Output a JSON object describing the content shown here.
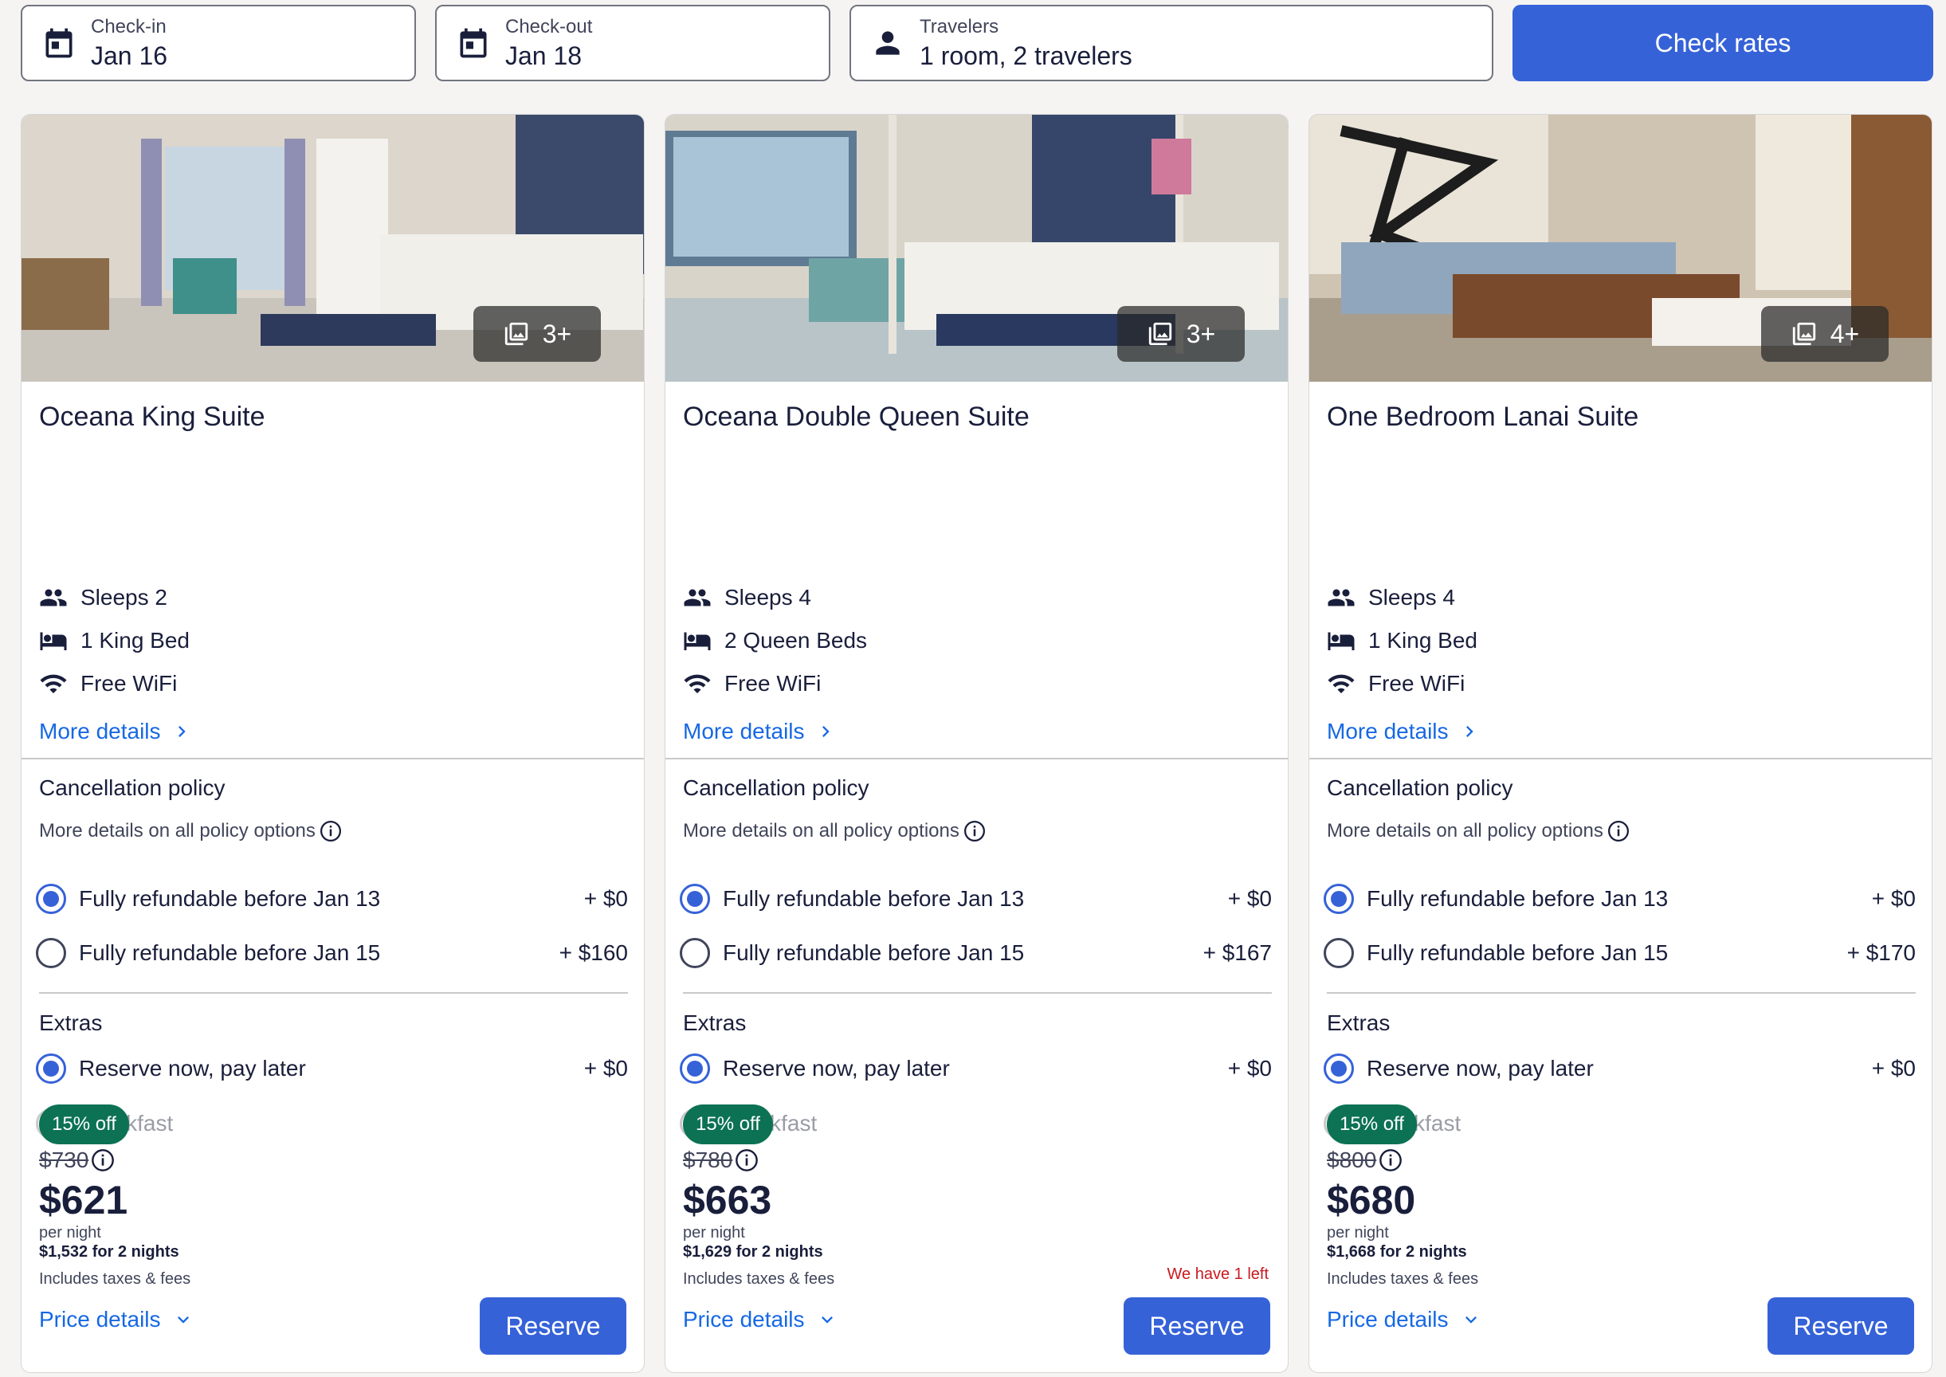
{
  "search": {
    "checkin": {
      "label": "Check-in",
      "value": "Jan 16"
    },
    "checkout": {
      "label": "Check-out",
      "value": "Jan 18"
    },
    "travelers": {
      "label": "Travelers",
      "value": "1 room, 2 travelers"
    },
    "check_rates": "Check rates"
  },
  "cards": [
    {
      "photo_count": "3+",
      "title": "Oceana King Suite",
      "sleeps": "Sleeps 2",
      "beds": "1 King Bed",
      "wifi": "Free WiFi",
      "more_details": "More details",
      "cancel_title": "Cancellation policy",
      "cancel_sub": "More details on all policy options",
      "opt1": {
        "label": "Fully refundable before Jan 13",
        "price": "+ $0"
      },
      "opt2": {
        "label": "Fully refundable before Jan 15",
        "price": "+ $160"
      },
      "extras_title": "Extras",
      "extra1": {
        "label": "Reserve now, pay later",
        "price": "+ $0"
      },
      "extra2": {
        "label": "Breakfast"
      },
      "discount": "15% off",
      "old_price": "$730",
      "price": "$621",
      "per_night": "per night",
      "total": "$1,532 for 2 nights",
      "taxes": "Includes taxes & fees",
      "left": "",
      "price_details": "Price details",
      "reserve": "Reserve"
    },
    {
      "photo_count": "3+",
      "title": "Oceana Double Queen Suite",
      "sleeps": "Sleeps 4",
      "beds": "2 Queen Beds",
      "wifi": "Free WiFi",
      "more_details": "More details",
      "cancel_title": "Cancellation policy",
      "cancel_sub": "More details on all policy options",
      "opt1": {
        "label": "Fully refundable before Jan 13",
        "price": "+ $0"
      },
      "opt2": {
        "label": "Fully refundable before Jan 15",
        "price": "+ $167"
      },
      "extras_title": "Extras",
      "extra1": {
        "label": "Reserve now, pay later",
        "price": "+ $0"
      },
      "extra2": {
        "label": "Breakfast"
      },
      "discount": "15% off",
      "old_price": "$780",
      "price": "$663",
      "per_night": "per night",
      "total": "$1,629 for 2 nights",
      "taxes": "Includes taxes & fees",
      "left": "We have 1 left",
      "price_details": "Price details",
      "reserve": "Reserve"
    },
    {
      "photo_count": "4+",
      "title": "One Bedroom Lanai Suite",
      "sleeps": "Sleeps 4",
      "beds": "1 King Bed",
      "wifi": "Free WiFi",
      "more_details": "More details",
      "cancel_title": "Cancellation policy",
      "cancel_sub": "More details on all policy options",
      "opt1": {
        "label": "Fully refundable before Jan 13",
        "price": "+ $0"
      },
      "opt2": {
        "label": "Fully refundable before Jan 15",
        "price": "+ $170"
      },
      "extras_title": "Extras",
      "extra1": {
        "label": "Reserve now, pay later",
        "price": "+ $0"
      },
      "extra2": {
        "label": "Breakfast"
      },
      "discount": "15% off",
      "old_price": "$800",
      "price": "$680",
      "per_night": "per night",
      "total": "$1,668 for 2 nights",
      "taxes": "Includes taxes & fees",
      "left": "",
      "price_details": "Price details",
      "reserve": "Reserve"
    }
  ]
}
